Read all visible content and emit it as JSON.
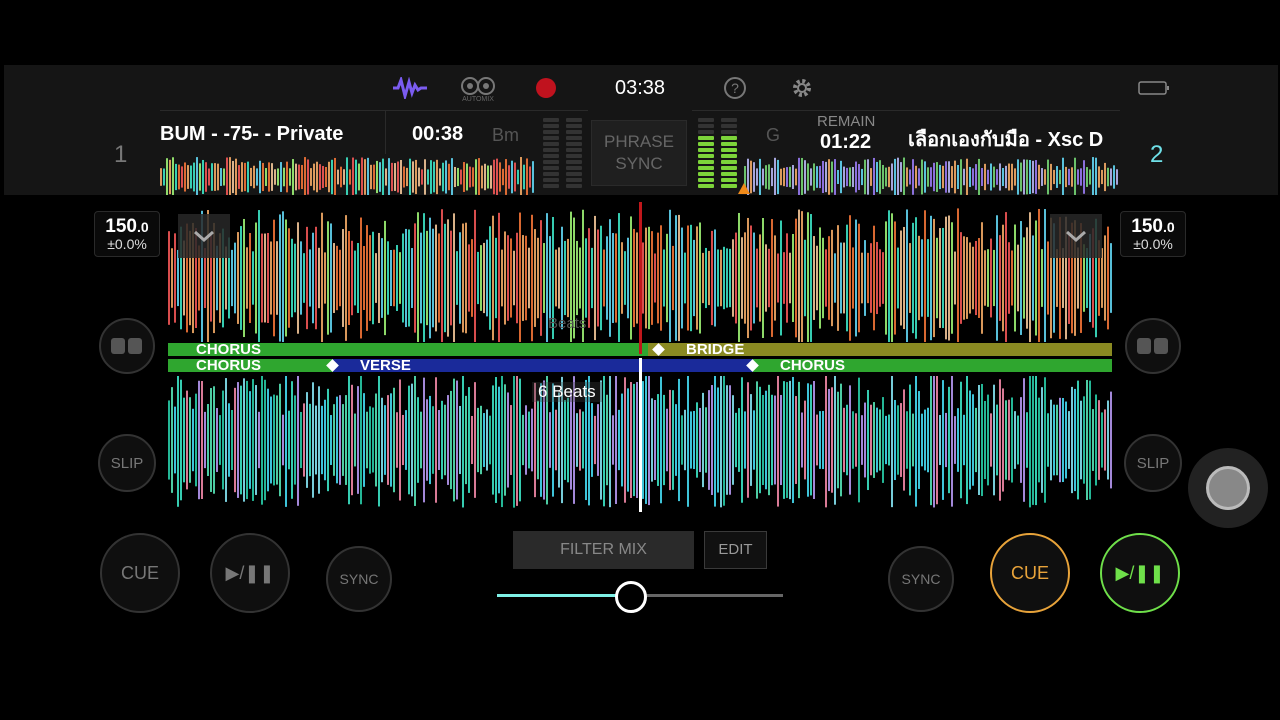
{
  "header": {
    "clock": "03:38",
    "automix_label": "AUTOMIX",
    "icons": [
      "waveform-icon",
      "automix-icon",
      "record-icon",
      "help-icon",
      "settings-icon",
      "battery-icon"
    ]
  },
  "deck1": {
    "number": "1",
    "title": "BUM - -75- - Private",
    "time": "00:38",
    "key": "Bm",
    "bpm_int": "150",
    "bpm_dec": ".0",
    "pitch": "±0.0%",
    "slip_label": "SLIP",
    "cue_label": "CUE",
    "play_label": "▶/❚❚",
    "sync_label": "SYNC",
    "phrases": [
      {
        "label": "CHORUS",
        "color": "#2fa62f"
      },
      {
        "label": "BRIDGE",
        "color": "#8a8a22"
      }
    ]
  },
  "deck2": {
    "number": "2",
    "title": "เลือกเองกับมือ - Xsc D",
    "remain_label": "REMAIN",
    "time": "01:22",
    "key": "G",
    "bpm_int": "150",
    "bpm_dec": ".0",
    "pitch": "±0.0%",
    "slip_label": "SLIP",
    "cue_label": "CUE",
    "play_label": "▶/❚❚",
    "sync_label": "SYNC",
    "phrases": [
      {
        "label": "CHORUS",
        "color": "#2fa62f"
      },
      {
        "label": "VERSE",
        "color": "#1a2a9a"
      },
      {
        "label": "CHORUS",
        "color": "#2fa62f"
      }
    ]
  },
  "center": {
    "phrase_sync": [
      "PHRASE",
      "SYNC"
    ],
    "beats_faded": "Beats",
    "beats_label": "6 Beats",
    "filter_mix": "FILTER MIX",
    "edit": "EDIT",
    "crossfader_level": 0.47
  },
  "colors": {
    "cue_active": "#e8a33a",
    "play_active": "#6fe04a",
    "deck2_number": "#6fe0e8",
    "playhead_deck1": "#c0171b",
    "playhead_deck2": "#ffffff",
    "filter_fill": "#7ff0e6"
  }
}
